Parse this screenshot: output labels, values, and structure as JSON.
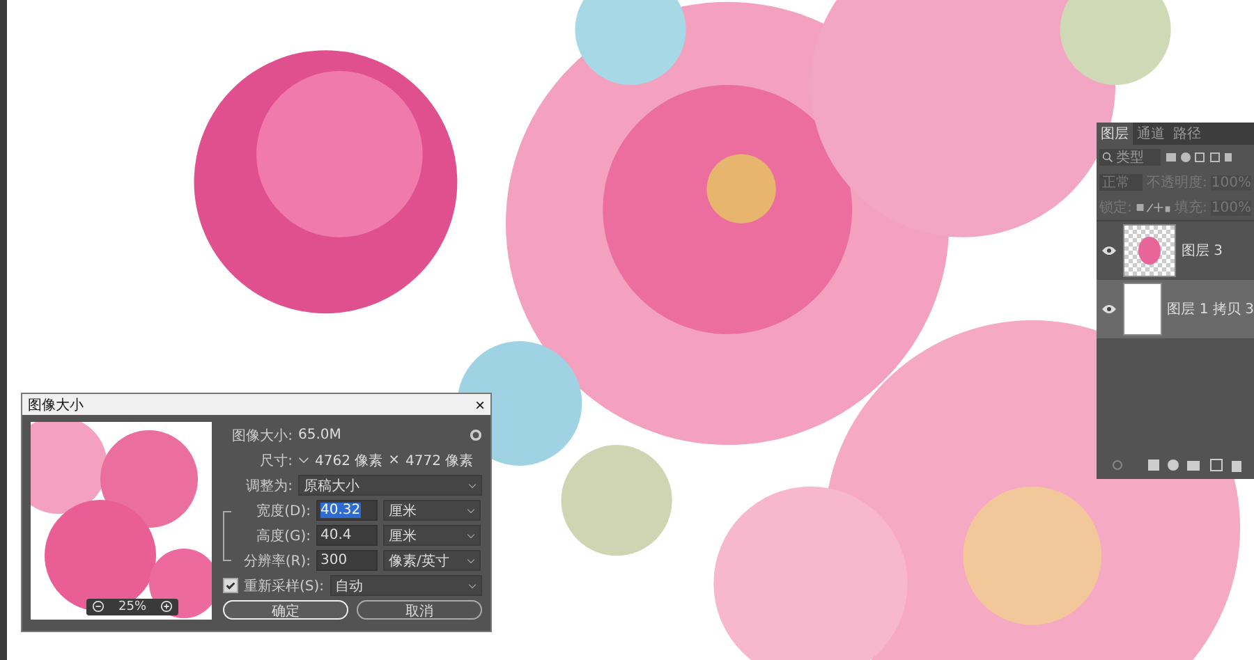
{
  "dialog": {
    "title": "图像大小",
    "close": "×",
    "preview_zoom": "25%",
    "image_size": {
      "label": "图像大小:",
      "value": "65.0M"
    },
    "dimensions": {
      "label": "尺寸:",
      "width": "4762 像素",
      "times": "×",
      "height": "4772 像素"
    },
    "fit_to": {
      "label": "调整为:",
      "value": "原稿大小"
    },
    "fields": [
      {
        "label": "宽度(D):",
        "value": "40.32",
        "unit": "厘米",
        "selected": true
      },
      {
        "label": "高度(G):",
        "value": "40.4",
        "unit": "厘米",
        "selected": false
      },
      {
        "label": "分辨率(R):",
        "value": "300",
        "unit": "像素/英寸",
        "selected": false
      }
    ],
    "resample": {
      "label": "重新采样(S):",
      "checked": true,
      "value": "自动"
    },
    "buttons": [
      {
        "label": "确定",
        "primary": true
      },
      {
        "label": "取消",
        "primary": false
      }
    ]
  },
  "layers_panel": {
    "tabs": [
      {
        "label": "图层",
        "selected": true
      },
      {
        "label": "通道",
        "selected": false
      },
      {
        "label": "路径",
        "selected": false
      }
    ],
    "filter_placeholder": "类型",
    "blend_mode": "正常",
    "opacity_label": "不透明度:",
    "opacity": "100%",
    "lock_label": "锁定:",
    "fill_label": "填充:",
    "fill": "100%",
    "layers": [
      {
        "name": "图层 3",
        "visible": true,
        "selected": false,
        "kind": "transparent"
      },
      {
        "name": "图层 1 拷贝 3",
        "visible": true,
        "selected": true,
        "kind": "white"
      }
    ]
  }
}
